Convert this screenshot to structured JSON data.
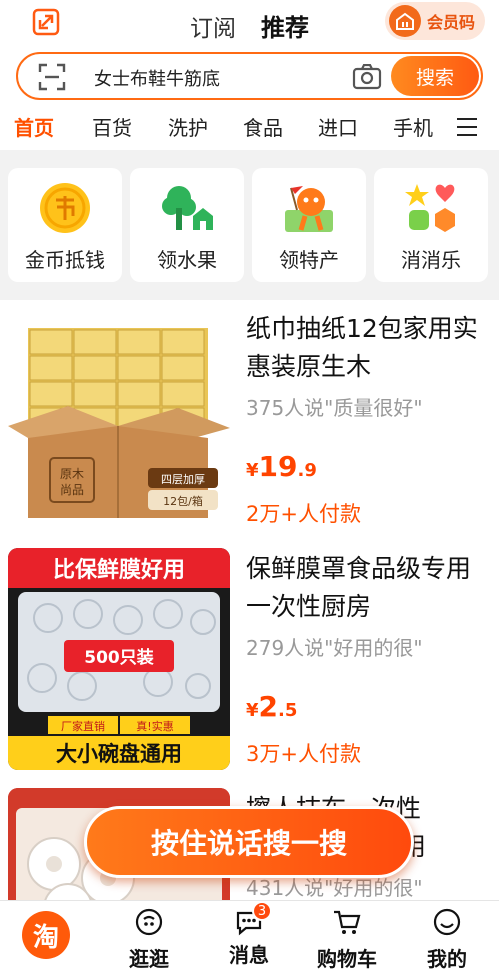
{
  "header": {
    "tabs": [
      {
        "label": "订阅",
        "active": false
      },
      {
        "label": "推荐",
        "active": true
      }
    ],
    "member_label": "会员码"
  },
  "search": {
    "placeholder": "女士布鞋牛筋底",
    "button_label": "搜索"
  },
  "categories": [
    {
      "label": "首页",
      "active": true
    },
    {
      "label": "百货",
      "active": false
    },
    {
      "label": "洗护",
      "active": false
    },
    {
      "label": "食品",
      "active": false
    },
    {
      "label": "进口",
      "active": false
    },
    {
      "label": "手机",
      "active": false
    }
  ],
  "shortcuts": [
    {
      "label": "金币抵钱",
      "icon": "gold-coin-icon"
    },
    {
      "label": "领水果",
      "icon": "tree-icon"
    },
    {
      "label": "领特产",
      "icon": "mascot-icon"
    },
    {
      "label": "消消乐",
      "icon": "match-game-icon"
    }
  ],
  "products": [
    {
      "title": "纸巾抽纸12包家用实惠装原生木",
      "reviews": "375人说\"质量很好\"",
      "currency": "¥",
      "price_int": "19",
      "price_dec": ".9",
      "paid": "2万+人付款",
      "image_text": [
        "原木",
        "尚品",
        "四层加厚",
        "12包/箱"
      ]
    },
    {
      "title": "保鲜膜罩食品级专用一次性厨房",
      "reviews": "279人说\"好用的很\"",
      "currency": "¥",
      "price_int": "2",
      "price_dec": ".5",
      "paid": "3万+人付款",
      "image_text": [
        "比保鲜膜好用",
        "500只装",
        "厂家直销",
        "真!实惠",
        "大小碗盘通用"
      ]
    },
    {
      "title": "擦人抹布一次性",
      "title_line2": "加用",
      "reviews": "431人说\"好用的很\""
    }
  ],
  "voice_button": "按住说话搜一搜",
  "bottom_nav": [
    {
      "label": "淘",
      "icon": "taobao-logo-icon"
    },
    {
      "label": "逛逛",
      "icon": "stroll-icon"
    },
    {
      "label": "消息",
      "icon": "message-icon",
      "badge": "3"
    },
    {
      "label": "购物车",
      "icon": "cart-icon"
    },
    {
      "label": "我的",
      "icon": "profile-icon"
    }
  ],
  "colors": {
    "accent": "#ff5000",
    "price": "#ff4400",
    "search_border": "#ff6a13"
  }
}
